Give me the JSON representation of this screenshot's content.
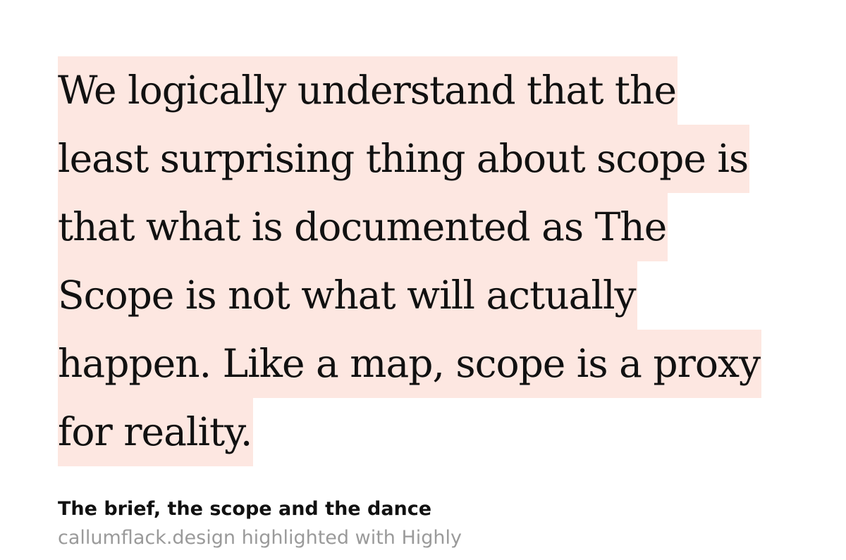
{
  "highlight": {
    "lines": [
      "We logically understand that the",
      "least surprising thing about scope is",
      "that what is documented as The",
      "Scope is not what will actually",
      "happen. Like a map, scope is a proxy",
      "for reality."
    ],
    "color": "#fde7e1"
  },
  "source": {
    "title": "The brief, the scope and the dance",
    "attribution": "callumflack.design highlighted with Highly"
  }
}
